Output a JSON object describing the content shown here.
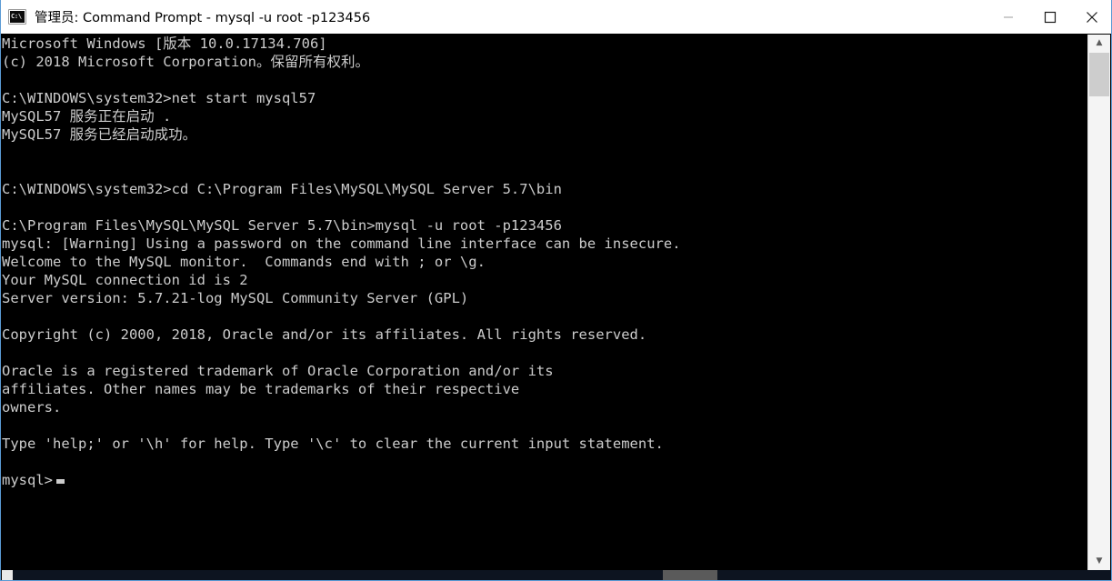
{
  "window": {
    "title": "管理员: Command Prompt - mysql  -u root -p123456",
    "icon": "cmd-console-icon",
    "icon_text": "C:\\",
    "controls": {
      "minimize": "minimize-button",
      "maximize": "maximize-button",
      "close": "close-button"
    },
    "colors": {
      "titlebar_bg": "#ffffff",
      "titlebar_text": "#000000",
      "window_border": "#5b9bd5",
      "console_bg": "#000000",
      "console_text": "#cccccc",
      "scrollbar_track": "#f4f4f4",
      "scrollbar_thumb": "#cdcdcd",
      "hscroll_track": "#0d1420",
      "hscroll_thumb": "#5a5a5a"
    }
  },
  "console": {
    "lines": [
      "Microsoft Windows [版本 10.0.17134.706]",
      "(c) 2018 Microsoft Corporation。保留所有权利。",
      "",
      "C:\\WINDOWS\\system32>net start mysql57",
      "MySQL57 服务正在启动 .",
      "MySQL57 服务已经启动成功。",
      "",
      "",
      "C:\\WINDOWS\\system32>cd C:\\Program Files\\MySQL\\MySQL Server 5.7\\bin",
      "",
      "C:\\Program Files\\MySQL\\MySQL Server 5.7\\bin>mysql -u root -p123456",
      "mysql: [Warning] Using a password on the command line interface can be insecure.",
      "Welcome to the MySQL monitor.  Commands end with ; or \\g.",
      "Your MySQL connection id is 2",
      "Server version: 5.7.21-log MySQL Community Server (GPL)",
      "",
      "Copyright (c) 2000, 2018, Oracle and/or its affiliates. All rights reserved.",
      "",
      "Oracle is a registered trademark of Oracle Corporation and/or its",
      "affiliates. Other names may be trademarks of their respective",
      "owners.",
      "",
      "Type 'help;' or '\\h' for help. Type '\\c' to clear the current input statement.",
      ""
    ],
    "prompt": "mysql>",
    "cursor": "block-cursor"
  },
  "scrollbars": {
    "vertical": {
      "up_arrow": "▲",
      "down_arrow": "▼"
    }
  }
}
